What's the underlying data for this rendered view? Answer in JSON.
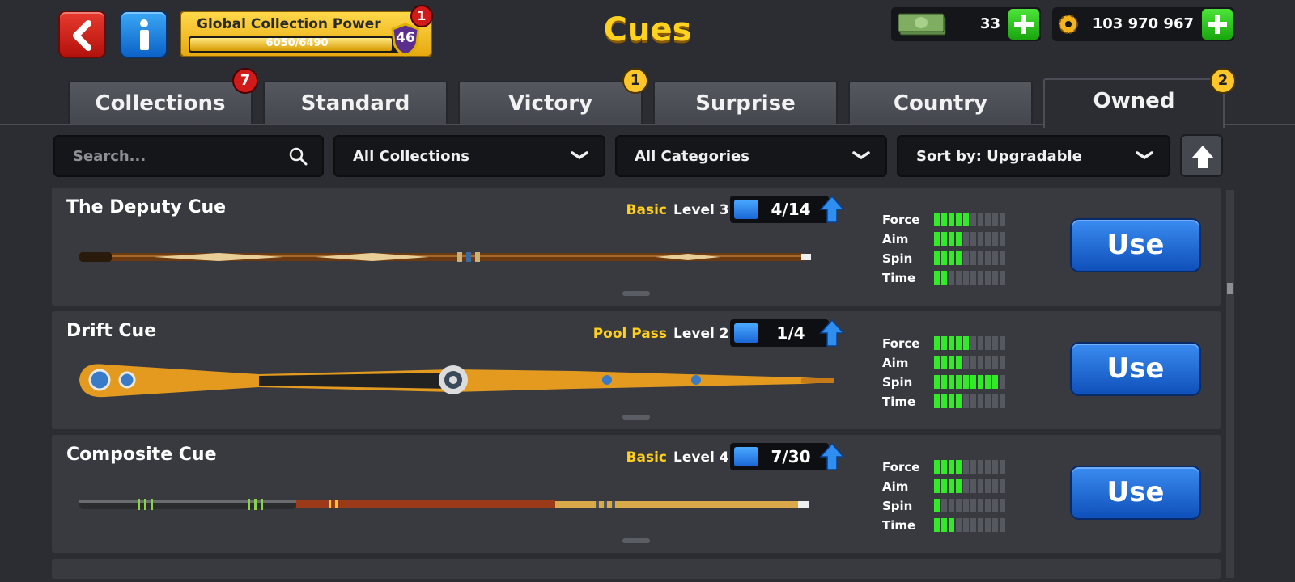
{
  "header": {
    "title": "Cues",
    "global_collection_power": {
      "label": "Global Collection Power",
      "value": "6050/6490",
      "level": "46",
      "badge": "1",
      "progress": 0.93
    }
  },
  "currency": {
    "cash": "33",
    "coins": "103 970 967"
  },
  "tabs": [
    {
      "label": "Collections",
      "badge": "7"
    },
    {
      "label": "Standard",
      "badge": ""
    },
    {
      "label": "Victory",
      "badge": "1"
    },
    {
      "label": "Surprise",
      "badge": ""
    },
    {
      "label": "Country",
      "badge": ""
    },
    {
      "label": "Owned",
      "badge": "2",
      "active": true
    }
  ],
  "filters": {
    "search_placeholder": "Search...",
    "collections": "All Collections",
    "categories": "All Categories",
    "sort": "Sort by: Upgradable"
  },
  "cues": [
    {
      "name": "The Deputy Cue",
      "rarity": "Basic",
      "level": "Level 3",
      "progress": "4/14",
      "use_label": "Use",
      "stats": [
        {
          "label": "Force",
          "value": 5
        },
        {
          "label": "Aim",
          "value": 4
        },
        {
          "label": "Spin",
          "value": 4
        },
        {
          "label": "Time",
          "value": 2
        }
      ]
    },
    {
      "name": "Drift Cue",
      "rarity": "Pool Pass",
      "level": "Level 2",
      "progress": "1/4",
      "use_label": "Use",
      "stats": [
        {
          "label": "Force",
          "value": 5
        },
        {
          "label": "Aim",
          "value": 4
        },
        {
          "label": "Spin",
          "value": 9
        },
        {
          "label": "Time",
          "value": 4
        }
      ]
    },
    {
      "name": "Composite Cue",
      "rarity": "Basic",
      "level": "Level 4",
      "progress": "7/30",
      "use_label": "Use",
      "stats": [
        {
          "label": "Force",
          "value": 4
        },
        {
          "label": "Aim",
          "value": 4
        },
        {
          "label": "Spin",
          "value": 1
        },
        {
          "label": "Time",
          "value": 3
        }
      ]
    }
  ],
  "colors": {
    "accent_yellow": "#ffd21f",
    "use_button": "#1e66d0",
    "stat_on": "#32ea28"
  }
}
